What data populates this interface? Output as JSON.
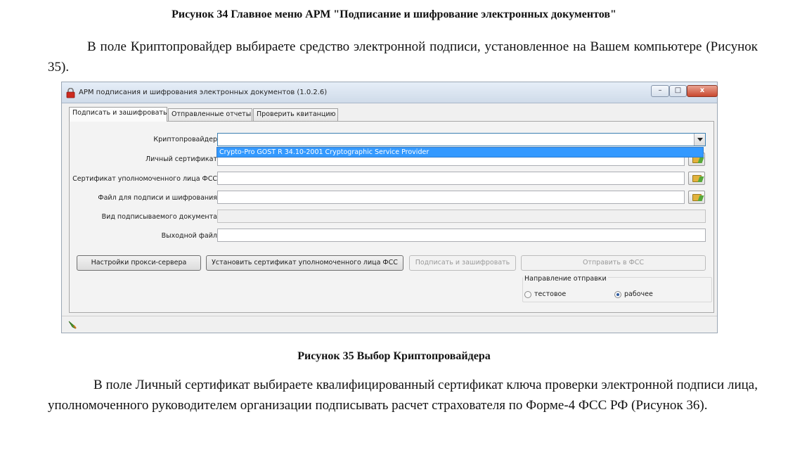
{
  "document": {
    "heading": "Рисунок 34 Главное меню АРМ \"Подписание и шифрование электронных документов\"",
    "para1": "В поле Криптопровайдер выбираете средство электронной подписи, установленное на Вашем компьютере (Рисунок 35).",
    "caption": "Рисунок 35 Выбор Криптопровайдера",
    "para2": "В поле Личный сертификат выбираете квалифицированный сертификат ключа проверки электронной подписи лица, уполномоченного руководителем организации подписывать расчет страхователя по Форме-4 ФСС РФ (Рисунок 36)."
  },
  "window": {
    "title": "АРМ подписания и шифрования электронных документов (1.0.2.6)",
    "controls": {
      "minimize": "–",
      "maximize": "□",
      "close": "x"
    },
    "tabs": [
      "Подписать и зашифровать",
      "Отправленные отчеты",
      "Проверить квитанцию"
    ],
    "form": {
      "crypto_label": "Криптопровайдер",
      "crypto_value": "",
      "crypto_dropdown_item": "Crypto-Pro GOST R 34.10-2001 Cryptographic Service Provider",
      "personal_cert_label": "Личный сертификат",
      "fss_cert_label": "Сертификат уполномоченного лица ФСС",
      "file_label": "Файл для подписи и шифрования",
      "doc_type_label": "Вид подписываемого документа",
      "output_label": "Выходной файл"
    },
    "buttons": {
      "proxy": "Настройки прокси-сервера",
      "install_cert": "Установить сертификат уполномоченного лица ФСС",
      "sign_encrypt": "Подписать и зашифровать",
      "send": "Отправить в ФСС"
    },
    "direction": {
      "title": "Направление отправки",
      "test": "тестовое",
      "work": "рабочее",
      "selected": "рабочее"
    }
  }
}
